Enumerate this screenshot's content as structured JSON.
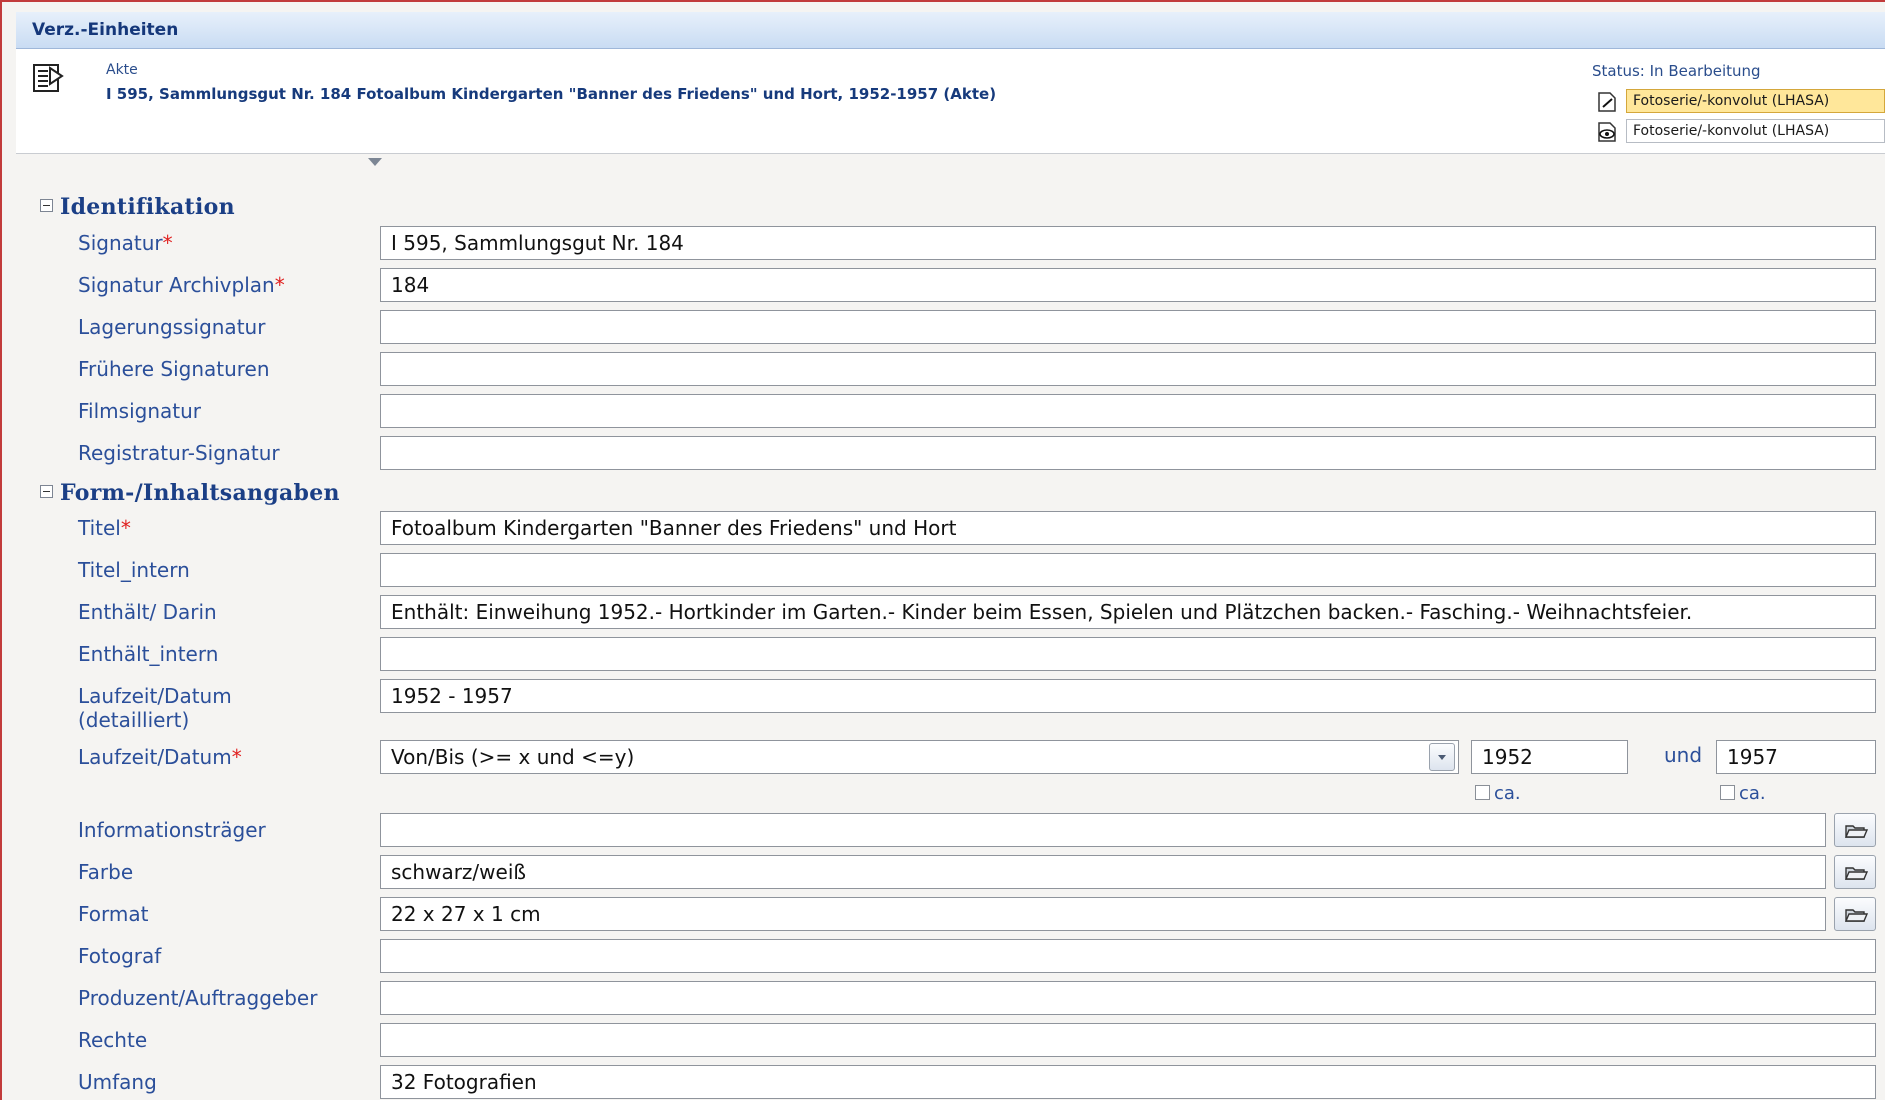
{
  "window": {
    "title": "Verz.-Einheiten"
  },
  "header": {
    "icon": "document-icon",
    "type_label": "Akte",
    "record_title": "I 595, Sammlungsgut Nr. 184   Fotoalbum Kindergarten \"Banner des Friedens\" und Hort, 1952-1957 (Akte)",
    "status": "Status: In Bearbeitung",
    "templates": [
      {
        "icon": "edit-document-icon",
        "label": "Fotoserie/-konvolut (LHASA)",
        "highlighted": true
      },
      {
        "icon": "view-document-icon",
        "label": "Fotoserie/-konvolut (LHASA)",
        "highlighted": false
      }
    ]
  },
  "sections": {
    "identifikation": {
      "title": "Identifikation",
      "fields": [
        {
          "label": "Signatur",
          "required": "*",
          "value": "I 595, Sammlungsgut Nr. 184"
        },
        {
          "label": "Signatur Archivplan",
          "required": "*",
          "value": "184"
        },
        {
          "label": "Lagerungssignatur",
          "required": "",
          "value": ""
        },
        {
          "label": "Frühere Signaturen",
          "required": "",
          "value": ""
        },
        {
          "label": "Filmsignatur",
          "required": "",
          "value": ""
        },
        {
          "label": "Registratur-Signatur",
          "required": "",
          "value": ""
        }
      ]
    },
    "inhalt": {
      "title": "Form-/Inhaltsangaben",
      "fields": [
        {
          "label": "Titel",
          "required": "*",
          "value": "Fotoalbum Kindergarten \"Banner des Friedens\" und Hort"
        },
        {
          "label": "Titel_intern",
          "required": "",
          "value": ""
        },
        {
          "label": "Enthält/ Darin",
          "required": "",
          "value": "Enthält: Einweihung 1952.- Hortkinder im Garten.- Kinder beim Essen, Spielen und Plätzchen backen.- Fasching.- Weihnachtsfeier."
        },
        {
          "label": "Enthält_intern",
          "required": "",
          "value": ""
        },
        {
          "label": "Laufzeit/Datum",
          "label2": "(detailliert)",
          "required": "",
          "value": "1952 - 1957"
        }
      ],
      "laufzeit": {
        "label": "Laufzeit/Datum",
        "required": "*",
        "mode": "Von/Bis (>= x und <=y)",
        "from": "1952",
        "and_label": "und",
        "to": "1957",
        "ca_label": "ca."
      },
      "fields2": [
        {
          "label": "Informationsträger",
          "value": "",
          "picker": true
        },
        {
          "label": "Farbe",
          "value": "schwarz/weiß",
          "picker": true
        },
        {
          "label": "Format",
          "value": "22 x 27 x 1 cm",
          "picker": true
        },
        {
          "label": "Fotograf",
          "value": ""
        },
        {
          "label": "Produzent/Auftraggeber",
          "value": ""
        },
        {
          "label": "Rechte",
          "value": ""
        },
        {
          "label": "Umfang",
          "value": "32 Fotografien"
        }
      ]
    }
  }
}
